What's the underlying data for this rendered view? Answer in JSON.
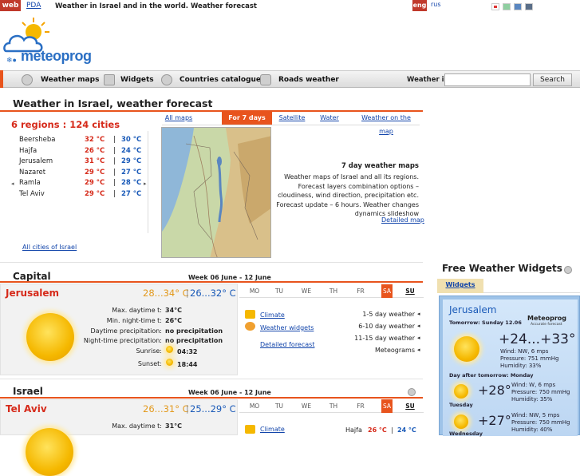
{
  "topbar": {
    "web": "web",
    "pda": "PDA",
    "title": "Weather in Israel and in the world. Weather forecast",
    "lang_eng": "eng",
    "lang_rus": "rus",
    "swatch_colors": [
      "#ffffff",
      "#8fcfa0",
      "#5a86c0",
      "#5a6e88"
    ]
  },
  "logo": {
    "text": "meteoprog"
  },
  "nav": {
    "items": [
      {
        "label": "Weather maps",
        "icon": "map-icon"
      },
      {
        "label": "Widgets",
        "icon": "widget-icon"
      },
      {
        "label": "Countries catalogue",
        "icon": "globe-icon"
      },
      {
        "label": "Roads weather",
        "icon": "car-icon"
      }
    ],
    "weather_in": "Weather in:",
    "search_value": "",
    "search_button": "Search"
  },
  "main": {
    "title": "Weather in Israel, weather forecast",
    "regions": "6 regions : 124 cities",
    "cities": [
      {
        "name": "Beersheba",
        "day": "32 °C",
        "sep": "|",
        "night": "30 °C"
      },
      {
        "name": "Hajfa",
        "day": "26 °C",
        "sep": "|",
        "night": "24 °C"
      },
      {
        "name": "Jerusalem",
        "day": "31 °C",
        "sep": "|",
        "night": "29 °C"
      },
      {
        "name": "Nazaret",
        "day": "29 °C",
        "sep": "|",
        "night": "27 °C"
      },
      {
        "name": "Ramla",
        "day": "29 °C",
        "sep": "|",
        "night": "28 °C"
      },
      {
        "name": "Tel Aviv",
        "day": "29 °C",
        "sep": "|",
        "night": "27 °C"
      }
    ],
    "all_cities": "All cities of Israel",
    "map_tabs": [
      "All maps",
      "For 7 days",
      "Satellite",
      "Water",
      "Weather on the map"
    ],
    "map_title": "7 day weather maps",
    "map_desc": "Weather maps of Israel and all its regions. Forecast layers combination options – cloudiness, wind direction, precipitation etc. Forecast update – 6 hours. Weather changes dynamics slideshow",
    "detailed_map": "Detailed map"
  },
  "capital": {
    "heading": "Capital",
    "week": "Week 06 June - 12 June",
    "city": "Jerusalem",
    "day_range": "28...34° C",
    "sep": "|",
    "night_range": "26...32° C",
    "details": [
      {
        "label": "Max. daytime t:",
        "value": "34°C"
      },
      {
        "label": "Min. night-time t:",
        "value": "26°C"
      },
      {
        "label": "Daytime precipitation:",
        "value": "no precipitation"
      },
      {
        "label": "Night-time precipitation:",
        "value": "no precipitation"
      },
      {
        "label": "Sunrise:",
        "value": "04:32"
      },
      {
        "label": "Sunset:",
        "value": "18:44"
      }
    ],
    "days": [
      "MO",
      "TU",
      "WE",
      "TH",
      "FR",
      "SA",
      "SU"
    ],
    "links": [
      "Climate",
      "Weather widgets"
    ],
    "detailed_forecast": "Detailed forecast",
    "forecasts": [
      "1-5 day weather",
      "6-10 day weather",
      "11-15 day weather",
      "Meteograms"
    ]
  },
  "israel": {
    "heading": "Israel",
    "week": "Week 06 June - 12 June",
    "city": "Tel Aviv",
    "day_range": "26...31° C",
    "sep": "|",
    "night_range": "25...29° C",
    "details": [
      {
        "label": "Max. daytime t:",
        "value": "31°C"
      }
    ],
    "days": [
      "MO",
      "TU",
      "WE",
      "TH",
      "FR",
      "SA",
      "SU"
    ],
    "link": "Climate",
    "side_city": {
      "name": "Hajfa",
      "day": "26 °C",
      "sep": "|",
      "night": "24 °C"
    }
  },
  "sidebar": {
    "heading": "Free Weather Widgets",
    "tab": "Widgets",
    "widget": {
      "city": "Jerusalem",
      "date": "Tomorrow: Sunday 12.06",
      "brand": "Meteoprog",
      "brand_sub": "Accurate forecast",
      "temp_main": "+24...+33°",
      "main_details": [
        "Wind: NW, 6 mps",
        "Pressure: 751 mmHg",
        "Humidity: 33%"
      ],
      "after_tomorrow": "Day after tomorrow: Monday",
      "temp2": "+28°",
      "day2": "Tuesday",
      "details2": [
        "Wind: W, 6 mps",
        "Pressure: 750 mmHg",
        "Humidity: 35%"
      ],
      "temp3": "+27°",
      "day3": "Wednesday",
      "details3": [
        "Wind: NW, 5 mps",
        "Pressure: 750 mmHg",
        "Humidity: 40%"
      ]
    }
  }
}
